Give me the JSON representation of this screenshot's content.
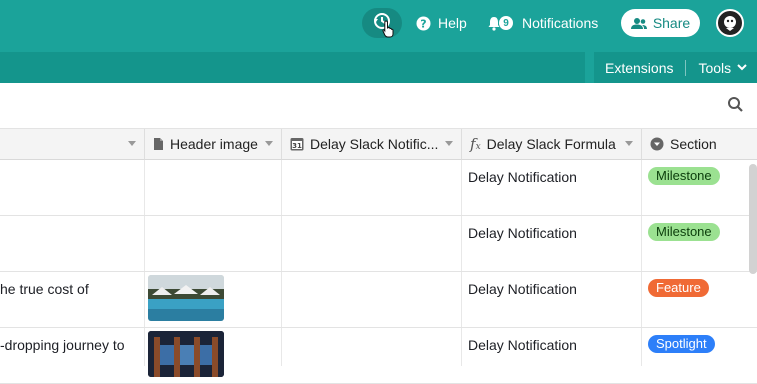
{
  "topbar": {
    "help_label": "Help",
    "notifications_badge": "9",
    "notifications_label": "Notifications",
    "share_label": "Share"
  },
  "subbar": {
    "extensions_label": "Extensions",
    "tools_label": "Tools"
  },
  "columns": [
    "Header image",
    "Delay Slack Notific...",
    "Delay Slack Formula",
    "Section"
  ],
  "rows": [
    {
      "name": "",
      "formula": "Delay Notification",
      "section": "Milestone",
      "section_color": "#9be191"
    },
    {
      "name": "",
      "formula": "Delay Notification",
      "section": "Milestone",
      "section_color": "#9be191"
    },
    {
      "name": "he true cost of",
      "formula": "Delay Notification",
      "section": "Feature",
      "section_color": "#f06a35"
    },
    {
      "name": "-dropping journey to",
      "formula": "Delay Notification",
      "section": "Spotlight",
      "section_color": "#2d7ff9"
    }
  ],
  "colors": {
    "brand": "#1ba39a",
    "brand_dark": "#14958c"
  }
}
